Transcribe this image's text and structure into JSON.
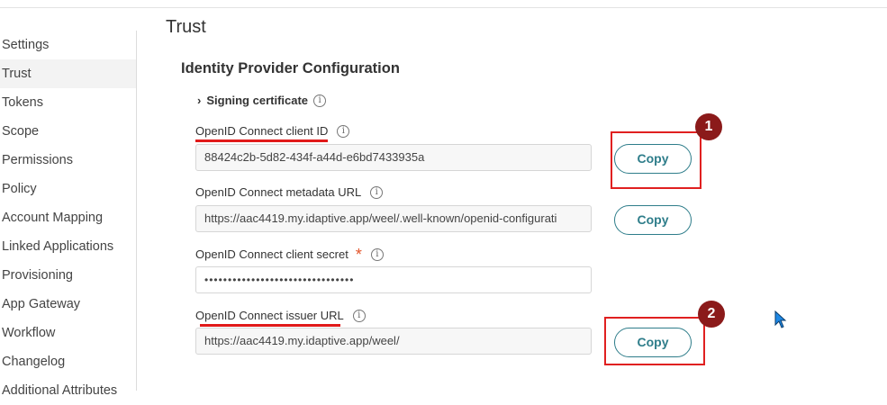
{
  "sidebar": {
    "items": [
      {
        "label": "Settings"
      },
      {
        "label": "Trust"
      },
      {
        "label": "Tokens"
      },
      {
        "label": "Scope"
      },
      {
        "label": "Permissions"
      },
      {
        "label": "Policy"
      },
      {
        "label": "Account Mapping"
      },
      {
        "label": "Linked Applications"
      },
      {
        "label": "Provisioning"
      },
      {
        "label": "App Gateway"
      },
      {
        "label": "Workflow"
      },
      {
        "label": "Changelog"
      },
      {
        "label": "Additional Attributes"
      }
    ],
    "active": "Trust"
  },
  "page": {
    "title": "Trust",
    "section_title": "Identity Provider Configuration",
    "signing_certificate_label": "Signing certificate"
  },
  "fields": {
    "client_id": {
      "label": "OpenID Connect client ID",
      "value": "88424c2b-5d82-434f-a44d-e6bd7433935a"
    },
    "metadata_url": {
      "label": "OpenID Connect metadata URL",
      "value": "https://aac4419.my.idaptive.app/weel/.well-known/openid-configurati"
    },
    "client_secret": {
      "label": "OpenID Connect client secret",
      "required_mark": "*",
      "value": "••••••••••••••••••••••••••••••••"
    },
    "issuer_url": {
      "label": "OpenID Connect issuer URL",
      "value": "https://aac4419.my.idaptive.app/weel/"
    }
  },
  "buttons": {
    "copy_label": "Copy"
  },
  "annotations": {
    "badge_1": "1",
    "badge_2": "2",
    "highlight_color": "#e02020",
    "badge_color": "#8b1a1a"
  },
  "icons": {
    "info": "ⓘ",
    "chevron": "›"
  },
  "colors": {
    "accent": "#2e7d8a",
    "required": "#e2542a"
  }
}
